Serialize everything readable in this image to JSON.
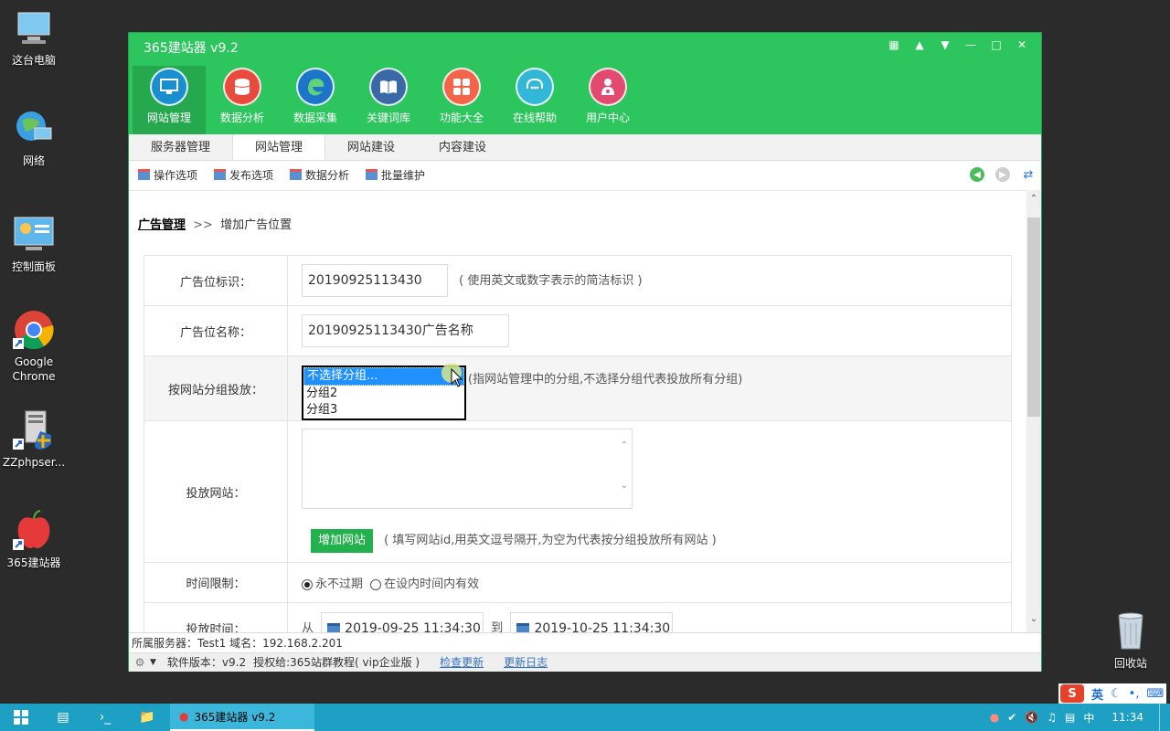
{
  "desktop": {
    "icons": [
      {
        "label": "这台电脑"
      },
      {
        "label": "网络"
      },
      {
        "label": "控制面板"
      },
      {
        "label": "Google Chrome"
      },
      {
        "label": "ZZphpser..."
      },
      {
        "label": "365建站器"
      },
      {
        "label": "回收站"
      }
    ]
  },
  "window": {
    "title": "365建站器 v9.2",
    "ribbon": [
      {
        "label": "网站管理",
        "color": "#1a8fd0"
      },
      {
        "label": "数据分析",
        "color": "#e84a3c"
      },
      {
        "label": "数据采集",
        "color": "#1c75c8"
      },
      {
        "label": "关键词库",
        "color": "#3a6aa5"
      },
      {
        "label": "功能大全",
        "color": "#f2654b"
      },
      {
        "label": "在线帮助",
        "color": "#32b8d6"
      },
      {
        "label": "用户中心",
        "color": "#e34a6f"
      }
    ],
    "tabs": [
      "服务器管理",
      "网站管理",
      "网站建设",
      "内容建设"
    ],
    "subtoolbar": [
      "操作选项",
      "发布选项",
      "数据分析",
      "批量维护"
    ]
  },
  "breadcrumb": {
    "link": "广告管理",
    "sep": ">>",
    "current": "增加广告位置"
  },
  "form": {
    "id_label": "广告位标识：",
    "id_value": "20190925113430",
    "id_hint": "( 使用英文或数字表示的简洁标识 )",
    "name_label": "广告位名称：",
    "name_value": "20190925113430广告名称",
    "group_label": "按网站分组投放：",
    "group_options": [
      "不选择分组...",
      "分组2",
      "分组3"
    ],
    "group_hint": "(指网站管理中的分组,不选择分组代表投放所有分组)",
    "site_label": "投放网站：",
    "add_site_button": "增加网站",
    "site_hint": "( 填写网站id,用英文逗号隔开,为空为代表按分组投放所有网站 )",
    "time_limit_label": "时间限制：",
    "never_expire": "永不过期",
    "within_time": "在设内时间内有效",
    "time_label": "投放时间：",
    "from": "从",
    "to": "到",
    "start_time": "2019-09-25 11:34:30",
    "end_time": "2019-10-25 11:34:30"
  },
  "status": {
    "server": "所属服务器：Test1 域名：192.168.2.201",
    "version": "软件版本：v9.2",
    "license": "授权给:365站群教程( vip企业版 )",
    "check_update": "检查更新",
    "changelog": "更新日志"
  },
  "taskbar": {
    "app": "365建站器 v9.2",
    "ime": "英",
    "ime_tray": "中",
    "time": "11:34"
  }
}
